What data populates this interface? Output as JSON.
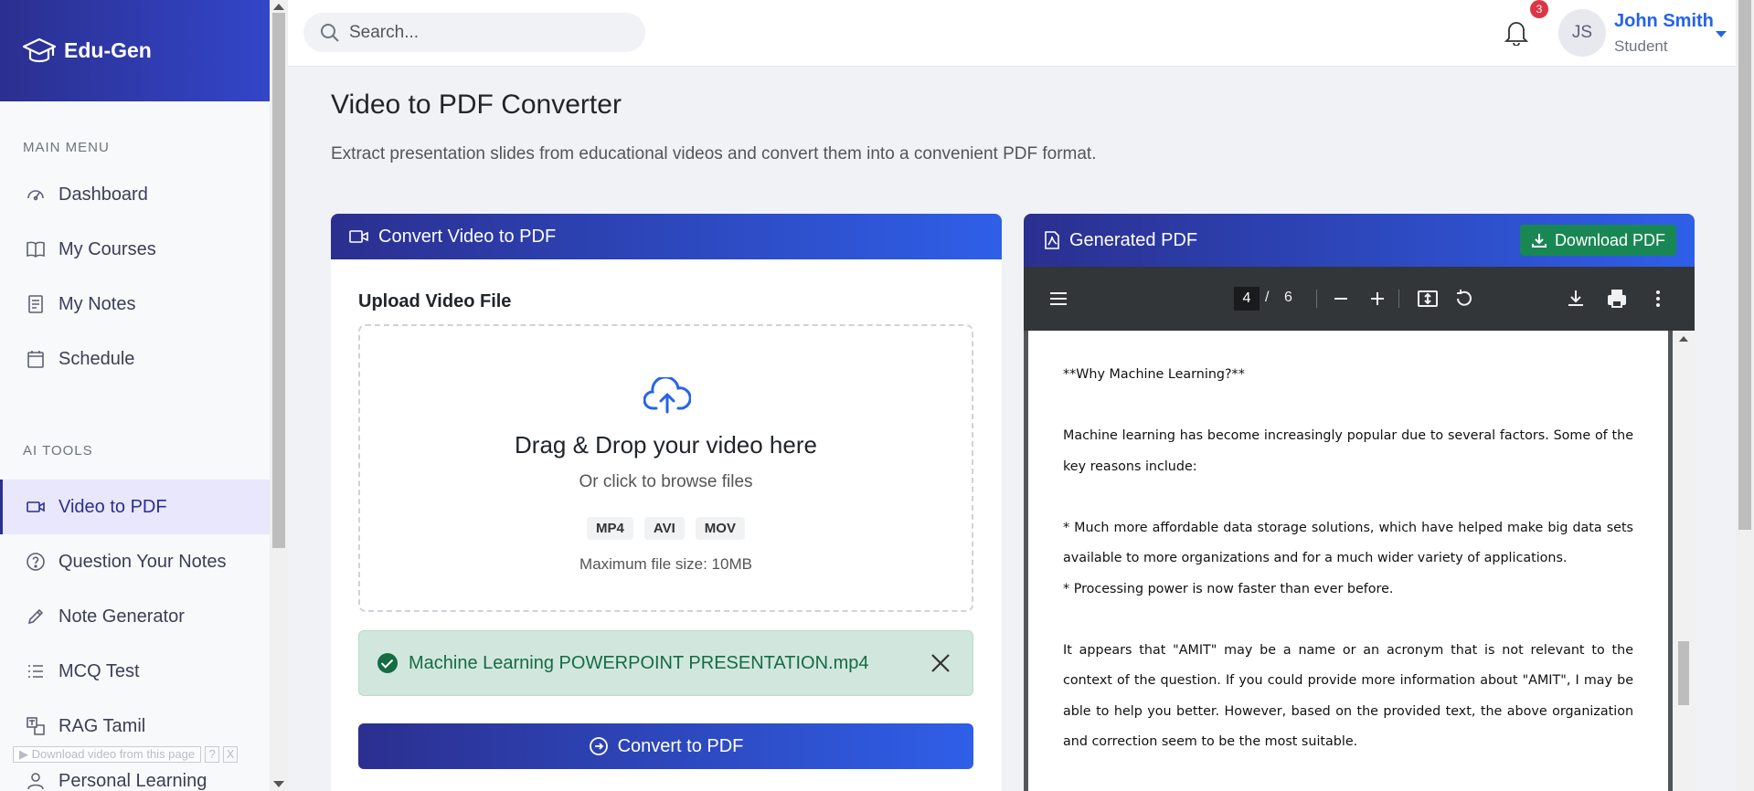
{
  "brand": {
    "name": "Edu-Gen",
    "icon": "graduation-cap-icon"
  },
  "sidebar": {
    "main_menu_label": "MAIN MENU",
    "main_items": [
      {
        "label": "Dashboard",
        "icon": "gauge-icon"
      },
      {
        "label": "My Courses",
        "icon": "book-icon"
      },
      {
        "label": "My Notes",
        "icon": "notes-icon"
      },
      {
        "label": "Schedule",
        "icon": "calendar-icon"
      }
    ],
    "ai_tools_label": "AI TOOLS",
    "ai_items": [
      {
        "label": "Video to PDF",
        "icon": "video-icon",
        "active": true
      },
      {
        "label": "Question Your Notes",
        "icon": "question-icon"
      },
      {
        "label": "Note Generator",
        "icon": "pencil-icon"
      },
      {
        "label": "MCQ Test",
        "icon": "list-icon"
      },
      {
        "label": "RAG Tamil",
        "icon": "translate-icon"
      },
      {
        "label": "Personal Learning",
        "icon": "person-icon"
      }
    ],
    "download_overlay": "Download video from this page",
    "download_overlay_help": "?",
    "download_overlay_close": "X"
  },
  "topbar": {
    "search_placeholder": "Search...",
    "notification_count": "3",
    "user_initials": "JS",
    "user_name": "John Smith",
    "user_role": "Student"
  },
  "page": {
    "title": "Video to PDF Converter",
    "subtitle": "Extract presentation slides from educational videos and convert them into a convenient PDF format."
  },
  "convert_card": {
    "header": "Convert Video to PDF",
    "upload_label": "Upload Video File",
    "dropzone_title": "Drag & Drop your video here",
    "dropzone_sub": "Or click to browse files",
    "formats": [
      "MP4",
      "AVI",
      "MOV"
    ],
    "max_size": "Maximum file size: 10MB",
    "selected_file": "Machine Learning POWERPOINT PRESENTATION.mp4",
    "convert_button": "Convert to PDF"
  },
  "pdf_card": {
    "header": "Generated PDF",
    "download_button": "Download PDF",
    "current_page": "4",
    "page_separator": "/",
    "total_pages": "6",
    "content": {
      "heading": "**Why Machine Learning?**",
      "para1": "Machine learning has become increasingly popular due to several factors. Some of the key reasons include:",
      "bullet1": "* Much more affordable data storage solutions, which have helped make big data sets available to more organizations and for a much wider variety of applications.",
      "bullet2": "* Processing power is now faster than ever before.",
      "para2": "It appears that \"AMIT\" may be a name or an acronym that is not relevant to the context of the question. If you could provide more information about \"AMIT\", I may be able to help you better. However, based on the provided text, the above organization and correction seem to be the most suitable."
    }
  },
  "colors": {
    "brand_gradient_start": "#2b2f8f",
    "brand_gradient_end": "#2f5fe8",
    "success": "#198754",
    "accent_blue": "#2563eb"
  }
}
